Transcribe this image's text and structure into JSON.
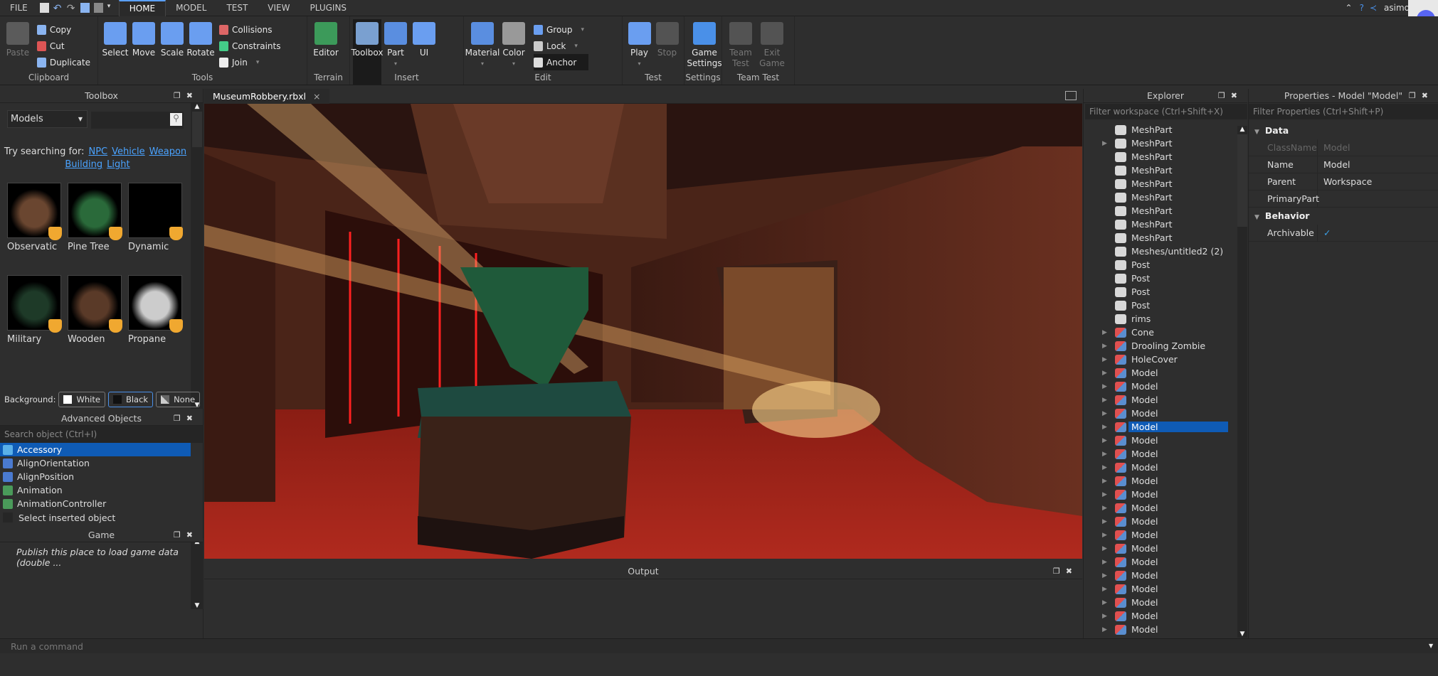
{
  "menubar": {
    "file": "FILE",
    "tabs": [
      "HOME",
      "MODEL",
      "TEST",
      "VIEW",
      "PLUGINS"
    ],
    "active_tab": "HOME",
    "user": "asimo"
  },
  "ribbon": {
    "groups": [
      {
        "label": "Clipboard",
        "large": [
          {
            "label": "Paste",
            "icon": "clipboard-icon",
            "color": "#888",
            "disabled": true
          }
        ],
        "small": [
          {
            "label": "Copy",
            "icon": "copy-icon",
            "color": "#8ab4f0"
          },
          {
            "label": "Cut",
            "icon": "scissors-icon",
            "color": "#d55"
          },
          {
            "label": "Duplicate",
            "icon": "duplicate-icon",
            "color": "#8ab4f0"
          }
        ]
      },
      {
        "label": "Tools",
        "large": [
          {
            "label": "Select",
            "icon": "cursor-icon",
            "color": "#6a9ef0"
          },
          {
            "label": "Move",
            "icon": "move-arrows-icon",
            "color": "#6a9ef0"
          },
          {
            "label": "Scale",
            "icon": "scale-icon",
            "color": "#6a9ef0"
          },
          {
            "label": "Rotate",
            "icon": "rotate-icon",
            "color": "#6a9ef0"
          }
        ],
        "small": [
          {
            "label": "Collisions",
            "icon": "collisions-icon",
            "color": "#d66"
          },
          {
            "label": "Constraints",
            "icon": "constraints-icon",
            "color": "#4c8"
          },
          {
            "label": "Join",
            "icon": "join-icon",
            "color": "#eee",
            "dropdown": true
          }
        ]
      },
      {
        "label": "Terrain",
        "large": [
          {
            "label": "Editor",
            "icon": "terrain-editor-icon",
            "color": "#3c9a5a"
          }
        ],
        "small": []
      },
      {
        "label": "Insert",
        "large": [
          {
            "label": "Toolbox",
            "icon": "toolbox-icon",
            "color": "#7aa0d0",
            "selected": true
          },
          {
            "label": "Part",
            "icon": "part-cube-icon",
            "color": "#5a8ee0",
            "dropdown": true
          },
          {
            "label": "UI",
            "icon": "ui-icon",
            "color": "#6a9ef0"
          }
        ],
        "small": []
      },
      {
        "label": "Edit",
        "large": [
          {
            "label": "Material",
            "icon": "material-icon",
            "color": "#5a8ee0",
            "dropdown": true
          },
          {
            "label": "Color",
            "icon": "color-swatch-icon",
            "color": "#999",
            "dropdown": true
          }
        ],
        "small": [
          {
            "label": "Group",
            "icon": "group-icon",
            "color": "#6a9ef0",
            "dropdown": true
          },
          {
            "label": "Lock",
            "icon": "lock-icon",
            "color": "#ccc",
            "dropdown": true
          },
          {
            "label": "Anchor",
            "icon": "anchor-icon",
            "color": "#ddd",
            "selected": true
          }
        ]
      },
      {
        "label": "Test",
        "large": [
          {
            "label": "Play",
            "icon": "play-icon",
            "color": "#6a9ef0",
            "dropdown": true
          },
          {
            "label": "Stop",
            "icon": "stop-icon",
            "color": "#777",
            "disabled": true
          }
        ],
        "small": []
      },
      {
        "label": "Settings",
        "large": [
          {
            "label": "Game Settings",
            "icon": "gear-icon",
            "color": "#4a90e8"
          }
        ],
        "small": []
      },
      {
        "label": "Team Test",
        "large": [
          {
            "label": "Team Test",
            "icon": "team-test-icon",
            "color": "#777",
            "disabled": true
          },
          {
            "label": "Exit Game",
            "icon": "exit-game-icon",
            "color": "#777",
            "disabled": true
          }
        ],
        "small": []
      }
    ]
  },
  "toolbox": {
    "title": "Toolbox",
    "category": "Models",
    "try_label": "Try searching for:",
    "suggestions": [
      "NPC",
      "Vehicle",
      "Weapon",
      "Building",
      "Light"
    ],
    "items": [
      {
        "name": "Observatic",
        "color": "#6a4630"
      },
      {
        "name": "Pine Tree",
        "color": "#2a6a3a"
      },
      {
        "name": "Dynamic",
        "color": "#000"
      },
      {
        "name": "Military",
        "color": "#1e3a28"
      },
      {
        "name": "Wooden",
        "color": "#5a3a28"
      },
      {
        "name": "Propane",
        "color": "#ccc"
      }
    ],
    "background_label": "Background:",
    "backgrounds": [
      "White",
      "Black",
      "None"
    ],
    "background_selected": "Black"
  },
  "advanced_objects": {
    "title": "Advanced Objects",
    "search_placeholder": "Search object (Ctrl+I)",
    "items": [
      "Accessory",
      "AlignOrientation",
      "AlignPosition",
      "Animation",
      "AnimationController"
    ],
    "selected": "Accessory",
    "select_inserted_label": "Select inserted object"
  },
  "game": {
    "title": "Game",
    "message": "Publish this place to load game data (double ..."
  },
  "document_tab": {
    "label": "MuseumRobbery.rbxl"
  },
  "output": {
    "title": "Output"
  },
  "explorer": {
    "title": "Explorer",
    "filter_placeholder": "Filter workspace (Ctrl+Shift+X)",
    "items": [
      {
        "label": "MeshPart",
        "kind": "mesh"
      },
      {
        "label": "MeshPart",
        "kind": "mesh",
        "expandable": true
      },
      {
        "label": "MeshPart",
        "kind": "mesh"
      },
      {
        "label": "MeshPart",
        "kind": "mesh"
      },
      {
        "label": "MeshPart",
        "kind": "mesh"
      },
      {
        "label": "MeshPart",
        "kind": "mesh"
      },
      {
        "label": "MeshPart",
        "kind": "mesh"
      },
      {
        "label": "MeshPart",
        "kind": "mesh"
      },
      {
        "label": "MeshPart",
        "kind": "mesh"
      },
      {
        "label": "Meshes/untitled2 (2)",
        "kind": "mesh"
      },
      {
        "label": "Post",
        "kind": "mesh"
      },
      {
        "label": "Post",
        "kind": "mesh"
      },
      {
        "label": "Post",
        "kind": "mesh"
      },
      {
        "label": "Post",
        "kind": "mesh"
      },
      {
        "label": "rims",
        "kind": "mesh"
      },
      {
        "label": "Cone",
        "kind": "model",
        "expandable": true
      },
      {
        "label": "Drooling Zombie",
        "kind": "model",
        "expandable": true
      },
      {
        "label": "HoleCover",
        "kind": "model",
        "expandable": true
      },
      {
        "label": "Model",
        "kind": "model",
        "expandable": true
      },
      {
        "label": "Model",
        "kind": "model",
        "expandable": true
      },
      {
        "label": "Model",
        "kind": "model",
        "expandable": true
      },
      {
        "label": "Model",
        "kind": "model",
        "expandable": true
      },
      {
        "label": "Model",
        "kind": "model",
        "expandable": true,
        "selected": true
      },
      {
        "label": "Model",
        "kind": "model",
        "expandable": true
      },
      {
        "label": "Model",
        "kind": "model",
        "expandable": true
      },
      {
        "label": "Model",
        "kind": "model",
        "expandable": true
      },
      {
        "label": "Model",
        "kind": "model",
        "expandable": true
      },
      {
        "label": "Model",
        "kind": "model",
        "expandable": true
      },
      {
        "label": "Model",
        "kind": "model",
        "expandable": true
      },
      {
        "label": "Model",
        "kind": "model",
        "expandable": true
      },
      {
        "label": "Model",
        "kind": "model",
        "expandable": true
      },
      {
        "label": "Model",
        "kind": "model",
        "expandable": true
      },
      {
        "label": "Model",
        "kind": "model",
        "expandable": true
      },
      {
        "label": "Model",
        "kind": "model",
        "expandable": true
      },
      {
        "label": "Model",
        "kind": "model",
        "expandable": true
      },
      {
        "label": "Model",
        "kind": "model",
        "expandable": true
      },
      {
        "label": "Model",
        "kind": "model",
        "expandable": true
      },
      {
        "label": "Model",
        "kind": "model",
        "expandable": true
      }
    ]
  },
  "properties": {
    "title": "Properties - Model \"Model\"",
    "filter_placeholder": "Filter Properties (Ctrl+Shift+P)",
    "categories": [
      {
        "name": "Data",
        "rows": [
          {
            "key": "ClassName",
            "value": "Model",
            "readonly": true
          },
          {
            "key": "Name",
            "value": "Model"
          },
          {
            "key": "Parent",
            "value": "Workspace"
          },
          {
            "key": "PrimaryPart",
            "value": ""
          }
        ]
      },
      {
        "name": "Behavior",
        "rows": [
          {
            "key": "Archivable",
            "value": "✓",
            "checkbox": true
          }
        ]
      }
    ]
  },
  "command_bar": {
    "placeholder": "Run a command"
  },
  "colors": {
    "accent": "#0f5bb5",
    "link": "#4aa3ff",
    "badge": "#f0a830"
  }
}
